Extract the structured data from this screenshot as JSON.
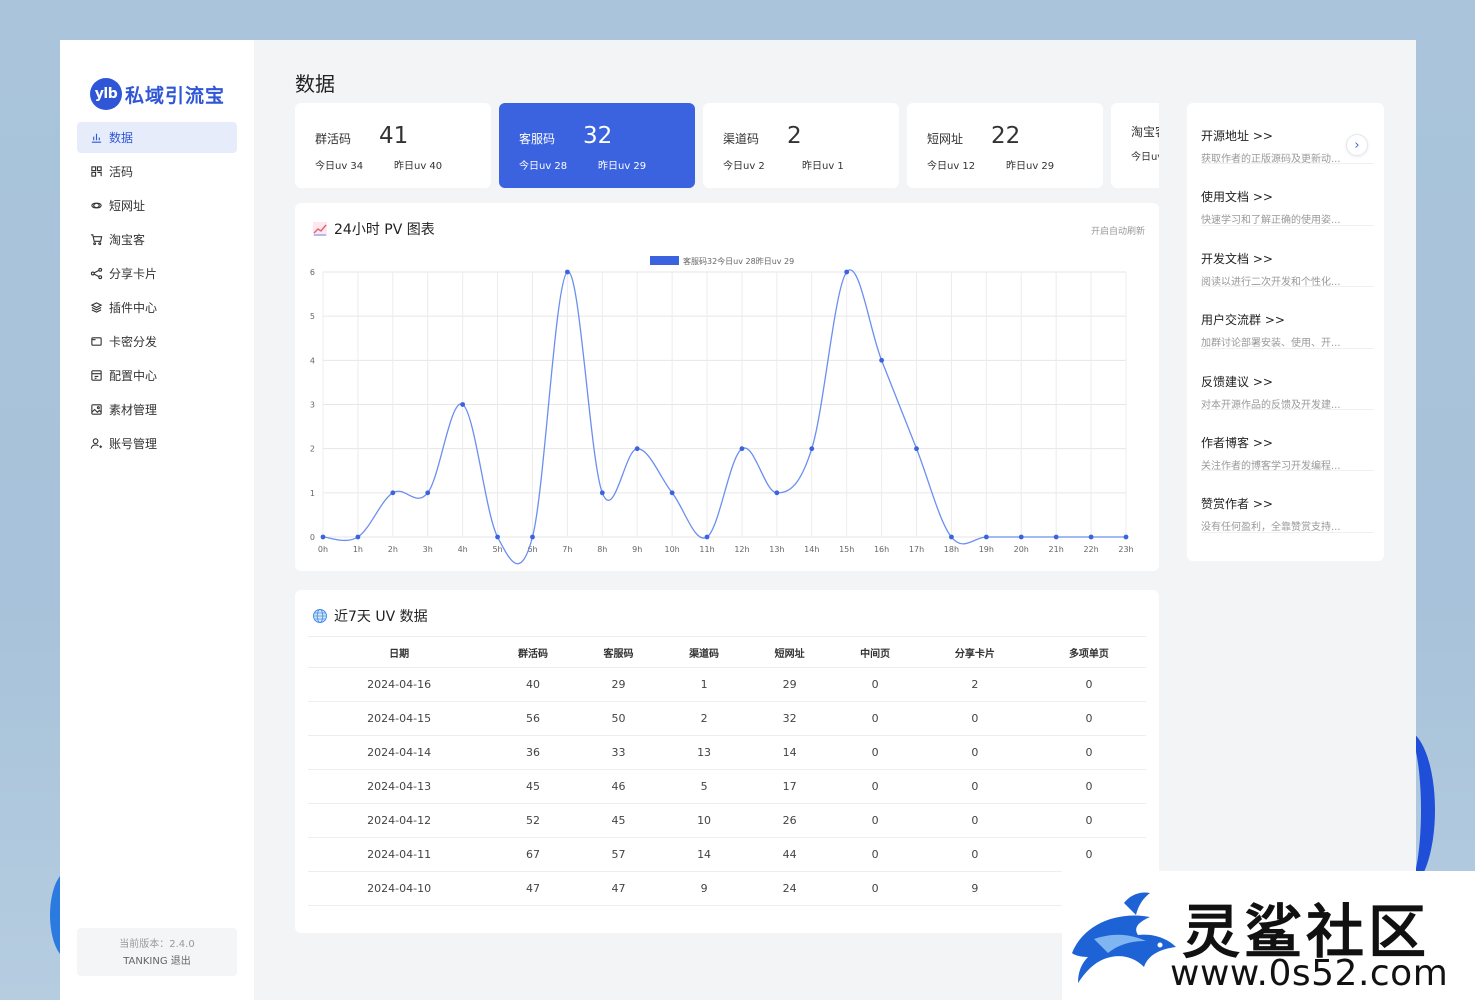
{
  "app": {
    "logo_badge": "ylb",
    "logo_text": "私域引流宝"
  },
  "sidebar": {
    "items": [
      {
        "label": "数据",
        "icon": "bar-chart-icon"
      },
      {
        "label": "活码",
        "icon": "grid-icon"
      },
      {
        "label": "短网址",
        "icon": "link-icon"
      },
      {
        "label": "淘宝客",
        "icon": "cart-icon"
      },
      {
        "label": "分享卡片",
        "icon": "share-icon"
      },
      {
        "label": "插件中心",
        "icon": "layers-icon"
      },
      {
        "label": "卡密分发",
        "icon": "card-icon"
      },
      {
        "label": "配置中心",
        "icon": "config-icon"
      },
      {
        "label": "素材管理",
        "icon": "image-icon"
      },
      {
        "label": "账号管理",
        "icon": "user-icon"
      }
    ],
    "version": "当前版本：2.4.0",
    "user_logout": "TANKING 退出"
  },
  "page": {
    "title": "数据"
  },
  "cards": [
    {
      "label": "群活码",
      "value": "41",
      "today": "今日uv 34",
      "yesterday": "昨日uv 40"
    },
    {
      "label": "客服码",
      "value": "32",
      "today": "今日uv 28",
      "yesterday": "昨日uv 29"
    },
    {
      "label": "渠道码",
      "value": "2",
      "today": "今日uv 2",
      "yesterday": "昨日uv 1"
    },
    {
      "label": "短网址",
      "value": "22",
      "today": "今日uv 12",
      "yesterday": "昨日uv 29"
    },
    {
      "label": "淘宝客",
      "value": "",
      "today": "今日uv",
      "yesterday": ""
    }
  ],
  "pv_panel": {
    "title": "24小时 PV 图表",
    "auto_refresh": "开启自动刷新"
  },
  "chart_data": {
    "type": "line",
    "legend": "客服码32今日uv 28昨日uv 29",
    "legend_position": "top-center",
    "color": "#3b63e0",
    "categories": [
      "0h",
      "1h",
      "2h",
      "3h",
      "4h",
      "5h",
      "6h",
      "7h",
      "8h",
      "9h",
      "10h",
      "11h",
      "12h",
      "13h",
      "14h",
      "15h",
      "16h",
      "17h",
      "18h",
      "19h",
      "20h",
      "21h",
      "22h",
      "23h"
    ],
    "values": [
      0,
      0,
      1,
      1,
      3,
      0,
      0,
      6,
      1,
      2,
      1,
      0,
      2,
      1,
      2,
      6,
      4,
      2,
      0,
      0,
      0,
      0,
      0,
      0
    ],
    "yticks": [
      0,
      1,
      2,
      3,
      4,
      5,
      6
    ],
    "ylim": [
      0,
      6
    ],
    "grid": true
  },
  "uv_panel": {
    "title": "近7天 UV 数据",
    "columns": [
      "日期",
      "群活码",
      "客服码",
      "渠道码",
      "短网址",
      "中间页",
      "分享卡片",
      "多项单页"
    ],
    "rows": [
      [
        "2024-04-16",
        "40",
        "29",
        "1",
        "29",
        "0",
        "2",
        "0"
      ],
      [
        "2024-04-15",
        "56",
        "50",
        "2",
        "32",
        "0",
        "0",
        "0"
      ],
      [
        "2024-04-14",
        "36",
        "33",
        "13",
        "14",
        "0",
        "0",
        "0"
      ],
      [
        "2024-04-13",
        "45",
        "46",
        "5",
        "17",
        "0",
        "0",
        "0"
      ],
      [
        "2024-04-12",
        "52",
        "45",
        "10",
        "26",
        "0",
        "0",
        "0"
      ],
      [
        "2024-04-11",
        "67",
        "57",
        "14",
        "44",
        "0",
        "0",
        "0"
      ],
      [
        "2024-04-10",
        "47",
        "47",
        "9",
        "24",
        "0",
        "9",
        ""
      ]
    ]
  },
  "links": [
    {
      "title": "开源地址 >>",
      "desc": "获取作者的正版源码及更新动..."
    },
    {
      "title": "使用文档 >>",
      "desc": "快速学习和了解正确的使用姿..."
    },
    {
      "title": "开发文档 >>",
      "desc": "阅读以进行二次开发和个性化..."
    },
    {
      "title": "用户交流群 >>",
      "desc": "加群讨论部署安装、使用、开..."
    },
    {
      "title": "反馈建议 >>",
      "desc": "对本开源作品的反馈及开发建..."
    },
    {
      "title": "作者博客 >>",
      "desc": "关注作者的博客学习开发编程..."
    },
    {
      "title": "赞赏作者 >>",
      "desc": "没有任何盈利，全靠赞赏支持..."
    }
  ],
  "watermark": {
    "cn": "灵鲨社区",
    "url": "www.0s52.com"
  }
}
